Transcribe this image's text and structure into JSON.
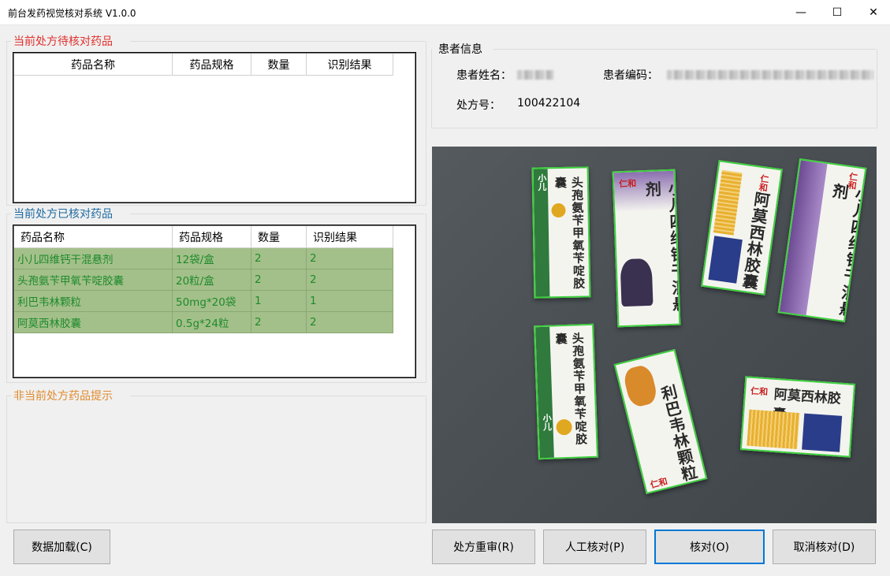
{
  "window": {
    "title": "前台发药视觉核对系统 V1.0.0",
    "minimize": "—",
    "maximize": "☐",
    "close": "✕"
  },
  "pending": {
    "title": "当前处方待核对药品",
    "columns": [
      "药品名称",
      "药品规格",
      "数量",
      "识别结果"
    ]
  },
  "verified": {
    "title": "当前处方已核对药品",
    "columns": [
      "药品名称",
      "药品规格",
      "数量",
      "识别结果"
    ],
    "rows": [
      {
        "name": "小儿四维钙干混悬剂",
        "spec": "12袋/盒",
        "qty": "2",
        "result": "2"
      },
      {
        "name": "头孢氨苄甲氧苄啶胶囊",
        "spec": "20粒/盒",
        "qty": "2",
        "result": "2"
      },
      {
        "name": "利巴韦林颗粒",
        "spec": "50mg*20袋",
        "qty": "1",
        "result": "1"
      },
      {
        "name": "阿莫西林胶囊",
        "spec": "0.5g*24粒",
        "qty": "2",
        "result": "2"
      }
    ]
  },
  "non_current": {
    "title": "非当前处方药品提示"
  },
  "patient": {
    "title": "患者信息",
    "name_label": "患者姓名：",
    "code_label": "患者编码：",
    "rx_label": "处方号：",
    "rx_value": "100422104"
  },
  "camera": {
    "boxes": [
      {
        "label": "头孢氨苄甲氧苄啶胶囊",
        "logo": "小儿"
      },
      {
        "label": "小儿四维钙干混悬剂",
        "logo": "仁和"
      },
      {
        "label": "阿莫西林胶囊",
        "logo": "仁和"
      },
      {
        "label": "小儿四维钙干混悬剂",
        "logo": "仁和"
      },
      {
        "label": "头孢氨苄甲氧苄啶胶囊",
        "logo": "小儿"
      },
      {
        "label": "利巴韦林颗粒",
        "logo": "仁和"
      },
      {
        "label": "阿莫西林胶囊",
        "logo": "仁和"
      }
    ]
  },
  "buttons": {
    "load": "数据加载(C)",
    "re_review": "处方重审(R)",
    "manual": "人工核对(P)",
    "verify": "核对(O)",
    "cancel": "取消核对(D)"
  },
  "colors": {
    "accent": "#0078d7",
    "verified_row_bg": "#a4c08a",
    "verified_row_text": "#1d8a2c",
    "pending_title": "#e0302e",
    "non_current_title": "#e08b2e",
    "detection_box": "#3ccf3c"
  }
}
